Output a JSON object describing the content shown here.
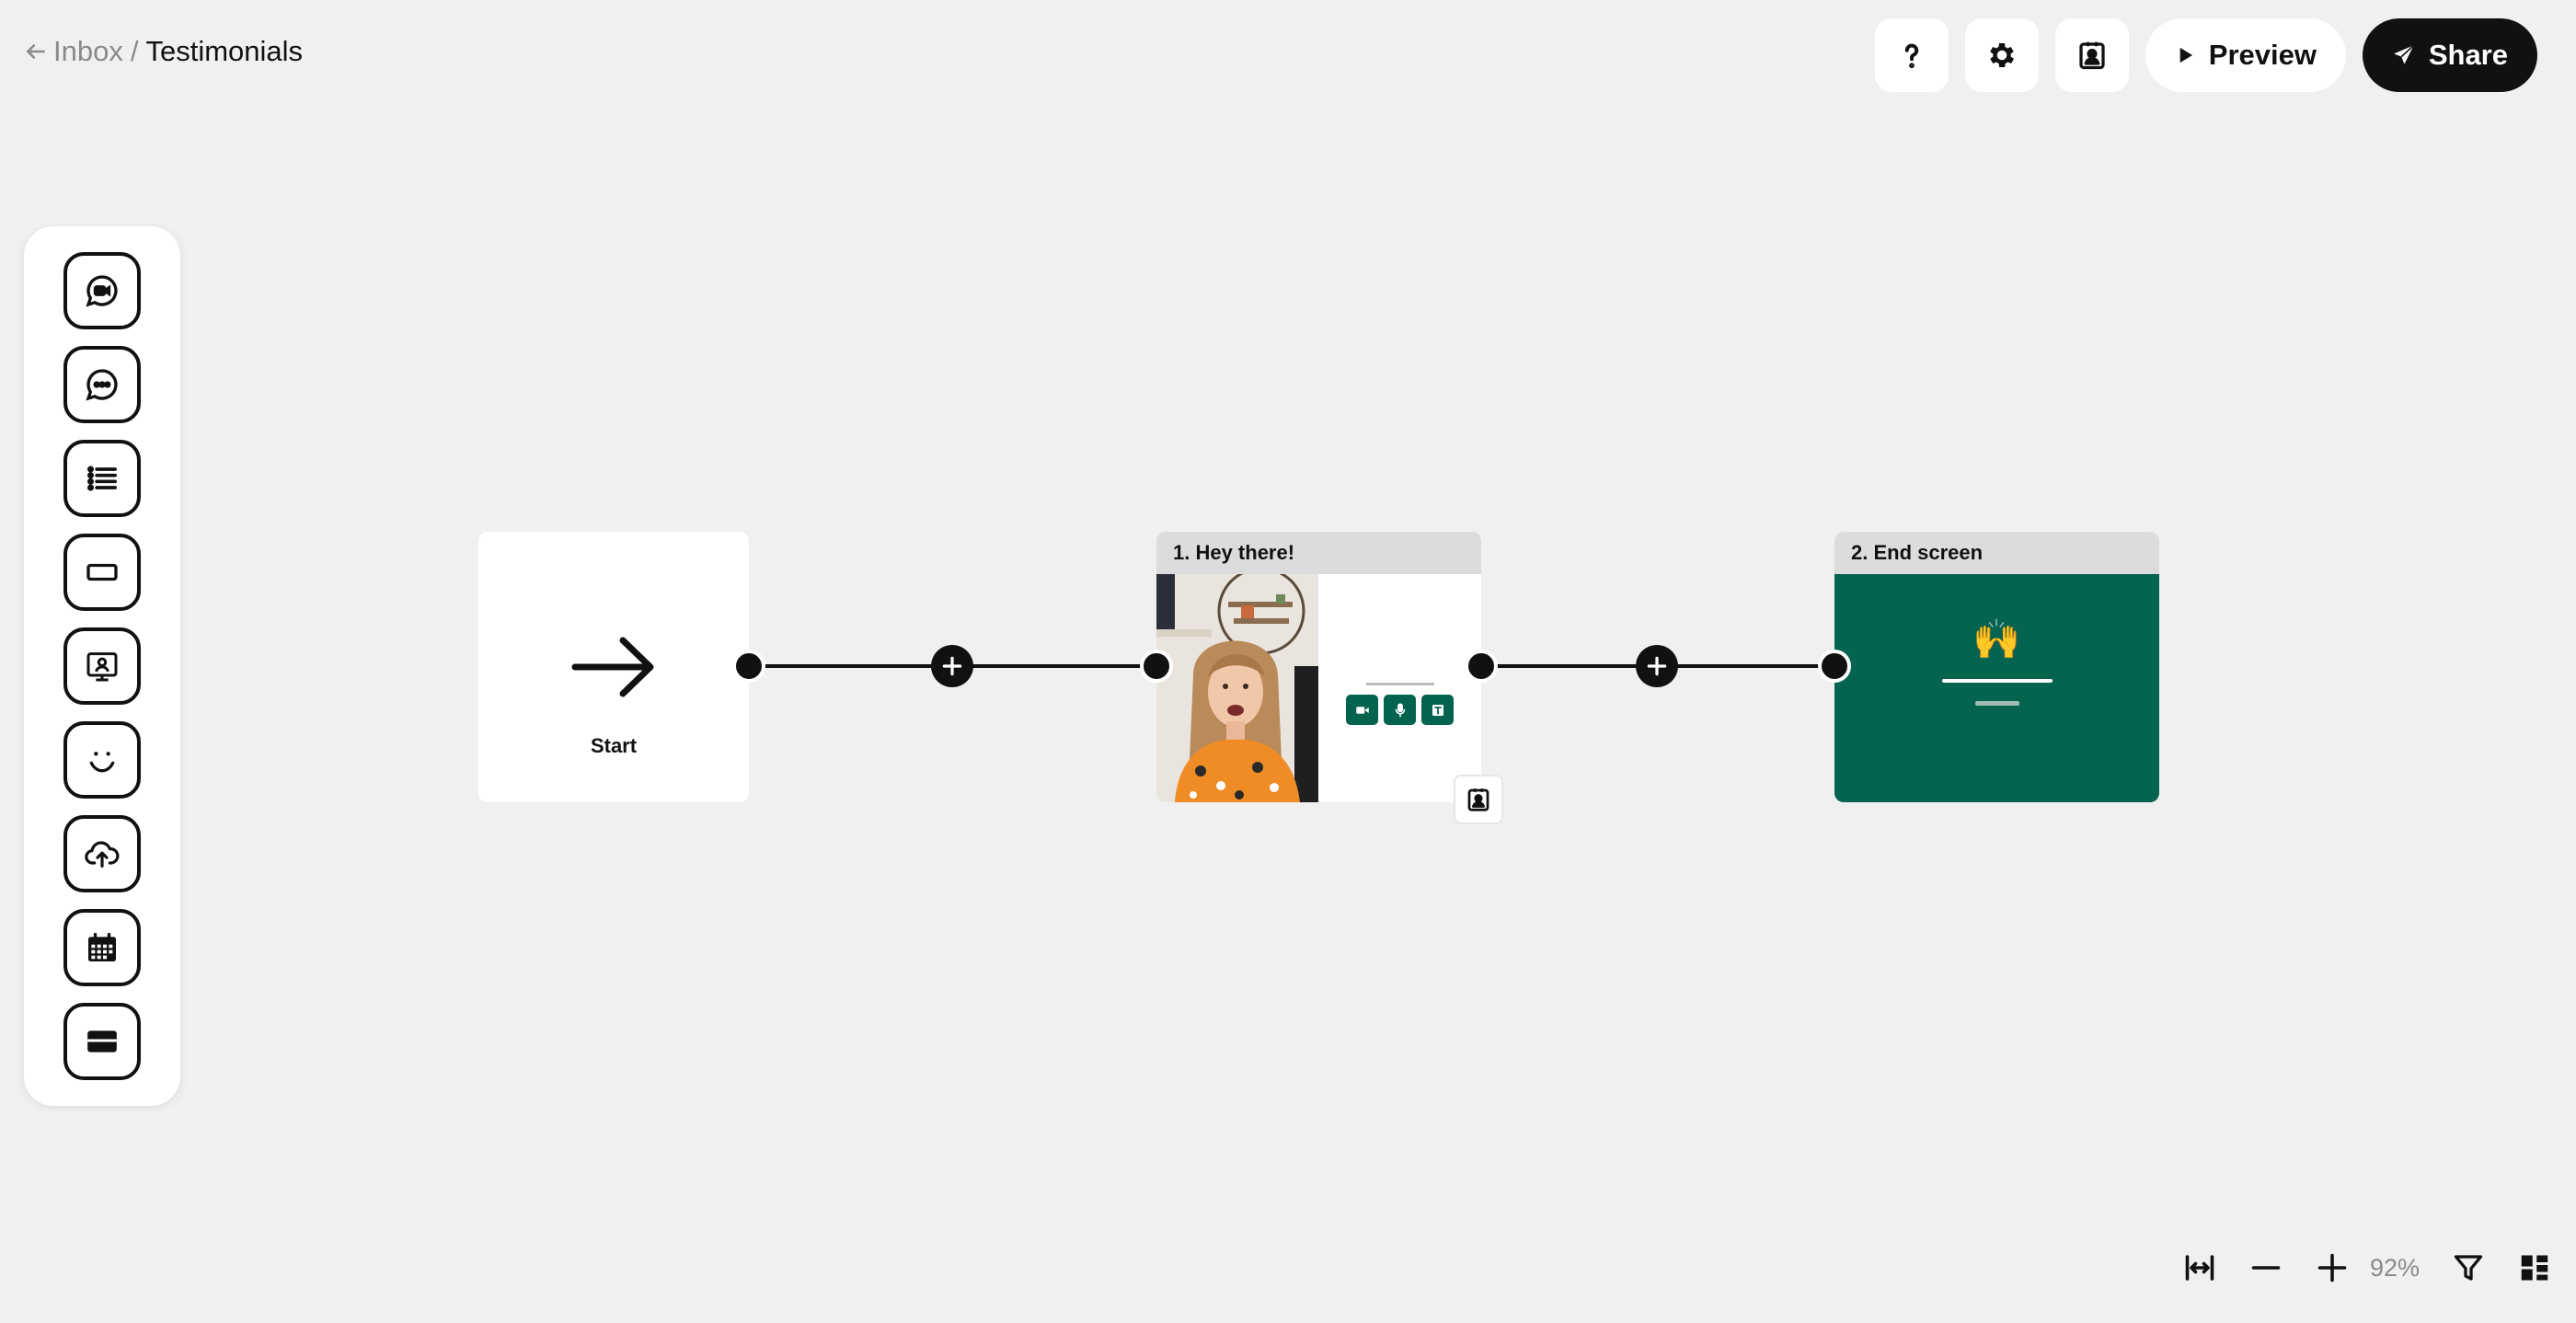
{
  "breadcrumb": {
    "parent": "Inbox",
    "separator": "/",
    "current": "Testimonials"
  },
  "toolbar": {
    "help_icon": "question-icon",
    "settings_icon": "gear-icon",
    "contact_icon": "contact-card-icon",
    "preview_label": "Preview",
    "share_label": "Share"
  },
  "palette": {
    "tools": [
      {
        "name": "video-question-tool",
        "icon": "video-chat-icon"
      },
      {
        "name": "text-question-tool",
        "icon": "chat-dots-icon"
      },
      {
        "name": "multiple-choice-tool",
        "icon": "list-icon"
      },
      {
        "name": "button-tool",
        "icon": "rectangle-icon"
      },
      {
        "name": "contact-form-tool",
        "icon": "contact-screen-icon"
      },
      {
        "name": "nps-tool",
        "icon": "smiley-icon"
      },
      {
        "name": "file-upload-tool",
        "icon": "cloud-upload-icon"
      },
      {
        "name": "calendar-tool",
        "icon": "calendar-icon"
      },
      {
        "name": "payment-tool",
        "icon": "credit-card-icon"
      }
    ]
  },
  "canvas": {
    "start_node": {
      "label": "Start"
    },
    "step1": {
      "title": "1. Hey there!"
    },
    "step2": {
      "title": "2. End screen",
      "emoji": "🙌"
    },
    "colors": {
      "brand_green": "#04644f"
    }
  },
  "zoom": {
    "value": "92%"
  }
}
